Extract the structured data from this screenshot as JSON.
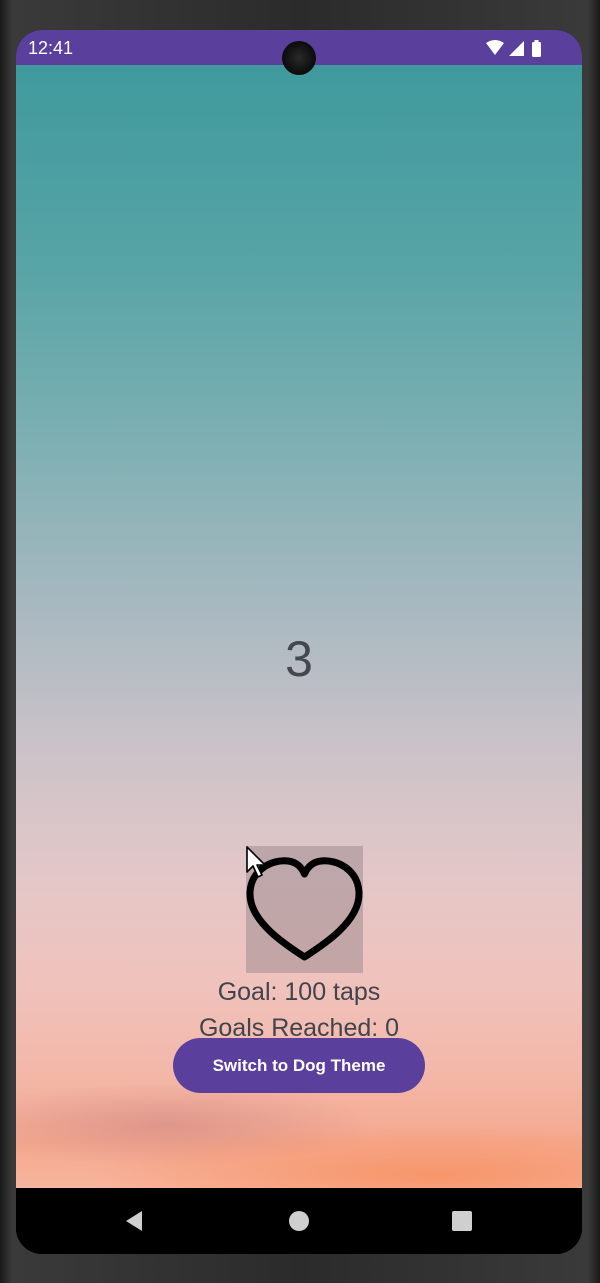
{
  "status_bar": {
    "time": "12:41",
    "icons": [
      "wifi-icon",
      "cellular-signal-icon",
      "battery-icon"
    ],
    "background_color": "#5b3f9c"
  },
  "app": {
    "tap_count": "3",
    "tap_target_icon": "heart-outline-icon",
    "goal_text": "Goal: 100 taps",
    "goals_reached_text": "Goals Reached: 0",
    "theme_button_label": "Switch to Dog Theme",
    "accent_color": "#5b3f9c"
  },
  "navigation_bar": {
    "buttons": [
      "back-icon",
      "home-icon",
      "recents-icon"
    ]
  }
}
